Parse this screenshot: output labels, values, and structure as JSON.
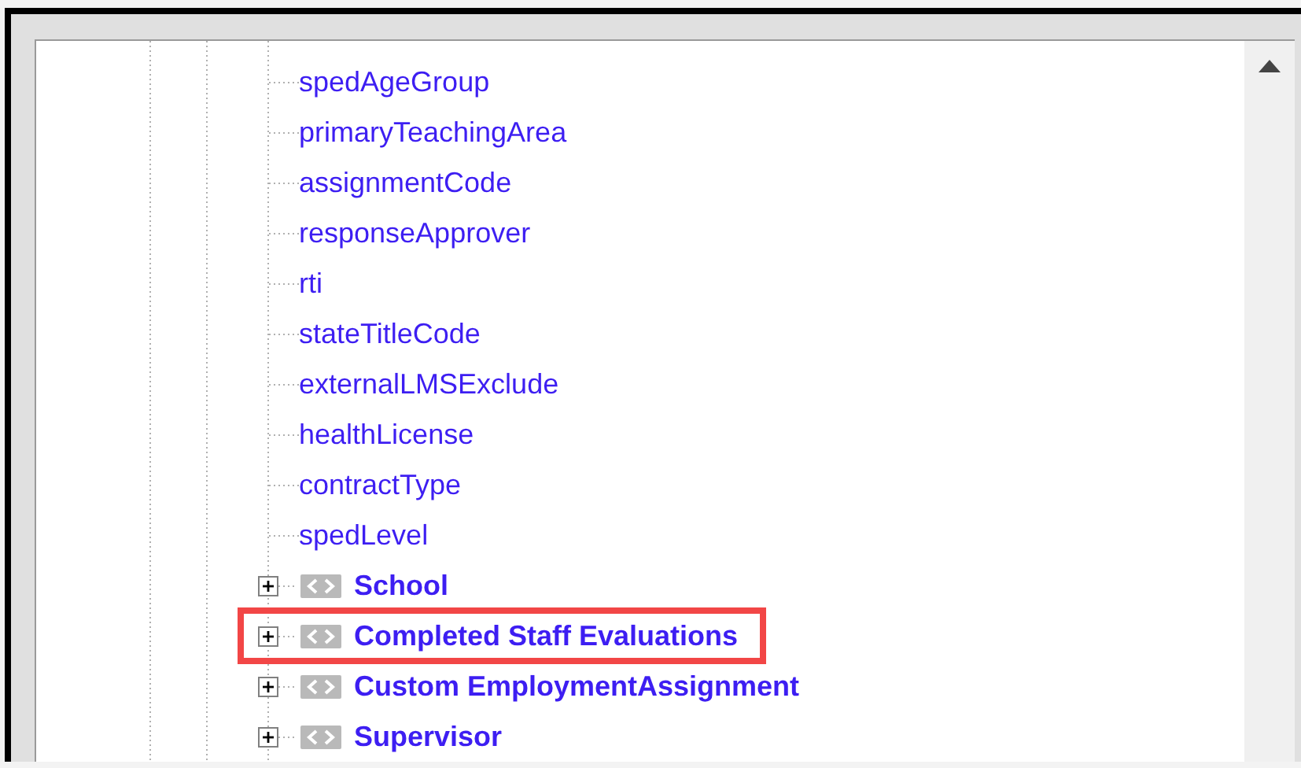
{
  "tree": {
    "items": [
      {
        "kind": "field",
        "label": "spedAgeGroup"
      },
      {
        "kind": "field",
        "label": "primaryTeachingArea"
      },
      {
        "kind": "field",
        "label": "assignmentCode"
      },
      {
        "kind": "field",
        "label": "responseApprover"
      },
      {
        "kind": "field",
        "label": "rti"
      },
      {
        "kind": "field",
        "label": "stateTitleCode"
      },
      {
        "kind": "field",
        "label": "externalLMSExclude"
      },
      {
        "kind": "field",
        "label": "healthLicense"
      },
      {
        "kind": "field",
        "label": "contractType"
      },
      {
        "kind": "field",
        "label": "spedLevel"
      },
      {
        "kind": "group",
        "label": "School",
        "expanded": false,
        "highlighted": false
      },
      {
        "kind": "group",
        "label": "Completed Staff Evaluations",
        "expanded": false,
        "highlighted": true
      },
      {
        "kind": "group",
        "label": "Custom EmploymentAssignment",
        "expanded": false,
        "highlighted": false
      },
      {
        "kind": "group",
        "label": "Supervisor",
        "expanded": false,
        "highlighted": false
      }
    ]
  }
}
